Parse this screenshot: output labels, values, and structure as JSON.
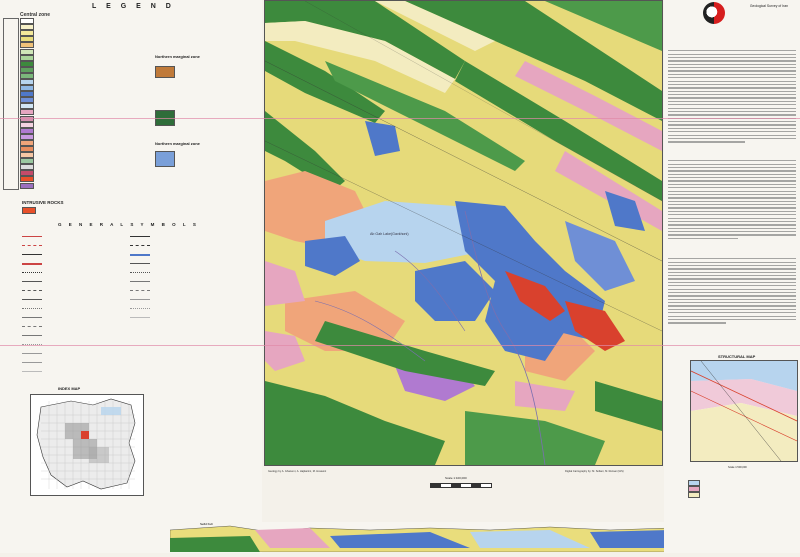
{
  "legend": {
    "title": "L E G E N D",
    "central_zone": "Central zone",
    "northern_marginal_zone": "Northern marginal zone",
    "northern_marginal_zone_2": "Northern marginal zone",
    "intrusive_rocks": "INTRUSIVE ROCKS",
    "general_symbols": "G E N E R A L   S Y M B O L S",
    "index_map": "INDEX MAP"
  },
  "map": {
    "lake_label": "Ab Gah Lake(Gavkhoni)",
    "scale": "Scale 1:100,000",
    "caption_left": "Geology by A. Ghanemi, A. Hajikarimi, M. Hosseini",
    "caption_right": "Digital Cartography by: M. Soltani, M. Rezaei (GIS)",
    "colors": {
      "green": "#3d8a3d",
      "yellow": "#e9dd7c",
      "blue": "#4f78c9",
      "lightblue": "#b7d4ee",
      "pink": "#e6a6c0",
      "salmon": "#f0a57a",
      "red": "#d9412d",
      "purple": "#b07ad0",
      "cream": "#f3ecc0"
    }
  },
  "right_panel": {
    "logo_text": "Geological Survey of Iran",
    "structural_map": "STRUCTURAL MAP",
    "struct_scale": "Scale 1:500,000"
  },
  "section": {
    "left_label": "Sefid Kuh",
    "right_label": "Kuh-e Sorkh"
  }
}
